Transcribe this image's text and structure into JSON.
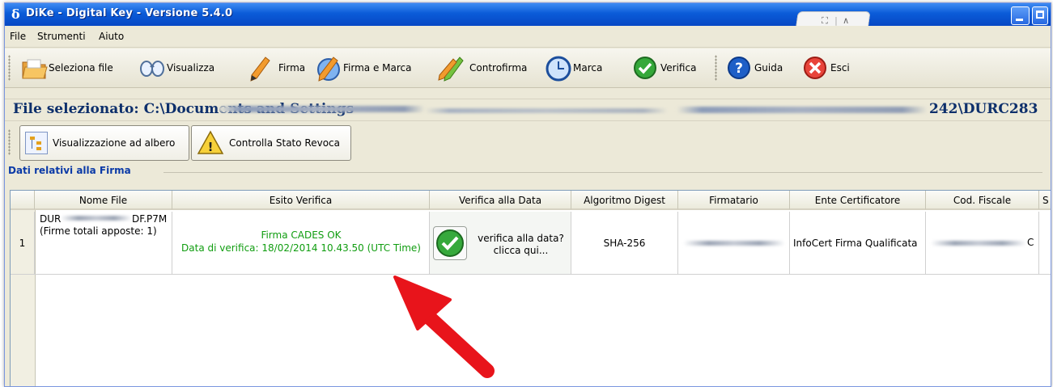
{
  "window": {
    "title": "DiKe - Digital Key - Versione 5.4.0",
    "app_symbol": "δ",
    "tabstrip_glyphs": [
      "⛶",
      "|",
      "∧"
    ]
  },
  "menu": {
    "items": [
      "File",
      "Strumenti",
      "Aiuto"
    ]
  },
  "toolbar": {
    "buttons": [
      {
        "label": "Seleziona file",
        "icon": "folder-icon"
      },
      {
        "label": "Visualizza",
        "icon": "glasses-icon"
      },
      {
        "label": "Firma",
        "icon": "pen-icon"
      },
      {
        "label": "Firma e Marca",
        "icon": "pen-clock-icon"
      },
      {
        "label": "Controfirma",
        "icon": "countersign-pen-icon"
      },
      {
        "label": "Marca",
        "icon": "clock-icon"
      },
      {
        "label": "Verifica",
        "icon": "check-circle-icon"
      },
      {
        "label": "Guida",
        "icon": "help-icon"
      },
      {
        "label": "Esci",
        "icon": "close-circle-icon"
      }
    ]
  },
  "file": {
    "prefix": "File selezionato: C:\\Documents and Settings",
    "suffix": "242\\DURC283"
  },
  "toolbar2": {
    "tree_view_label": "Visualizzazione ad albero",
    "revocation_label": "Controlla Stato Revoca"
  },
  "signature_group": {
    "legend": "Dati relativi alla Firma",
    "columns": [
      "Nome File",
      "Esito Verifica",
      "Verifica alla Data",
      "Algoritmo Digest",
      "Firmatario",
      "Ente Certificatore",
      "Cod. Fiscale",
      "S"
    ],
    "rows": [
      {
        "index": "1",
        "file_name_start": "DUR",
        "file_name_end": "DF.P7M",
        "signatures_total": "(Firme totali apposte: 1)",
        "result_line1": "Firma CADES OK",
        "result_line2": "Data di verifica: 18/02/2014  10.43.50 (UTC Time)",
        "verify_date_line1": "verifica alla data?",
        "verify_date_line2": "clicca qui...",
        "digest": "SHA-256",
        "certifier": "InfoCert Firma Qualificata",
        "tax_code_end": "C"
      }
    ]
  },
  "colors": {
    "titlebar": "#0a5bd8",
    "result_text": "#109d10",
    "arrow": "#e8141b",
    "file_path_text": "#0d2f6b"
  }
}
